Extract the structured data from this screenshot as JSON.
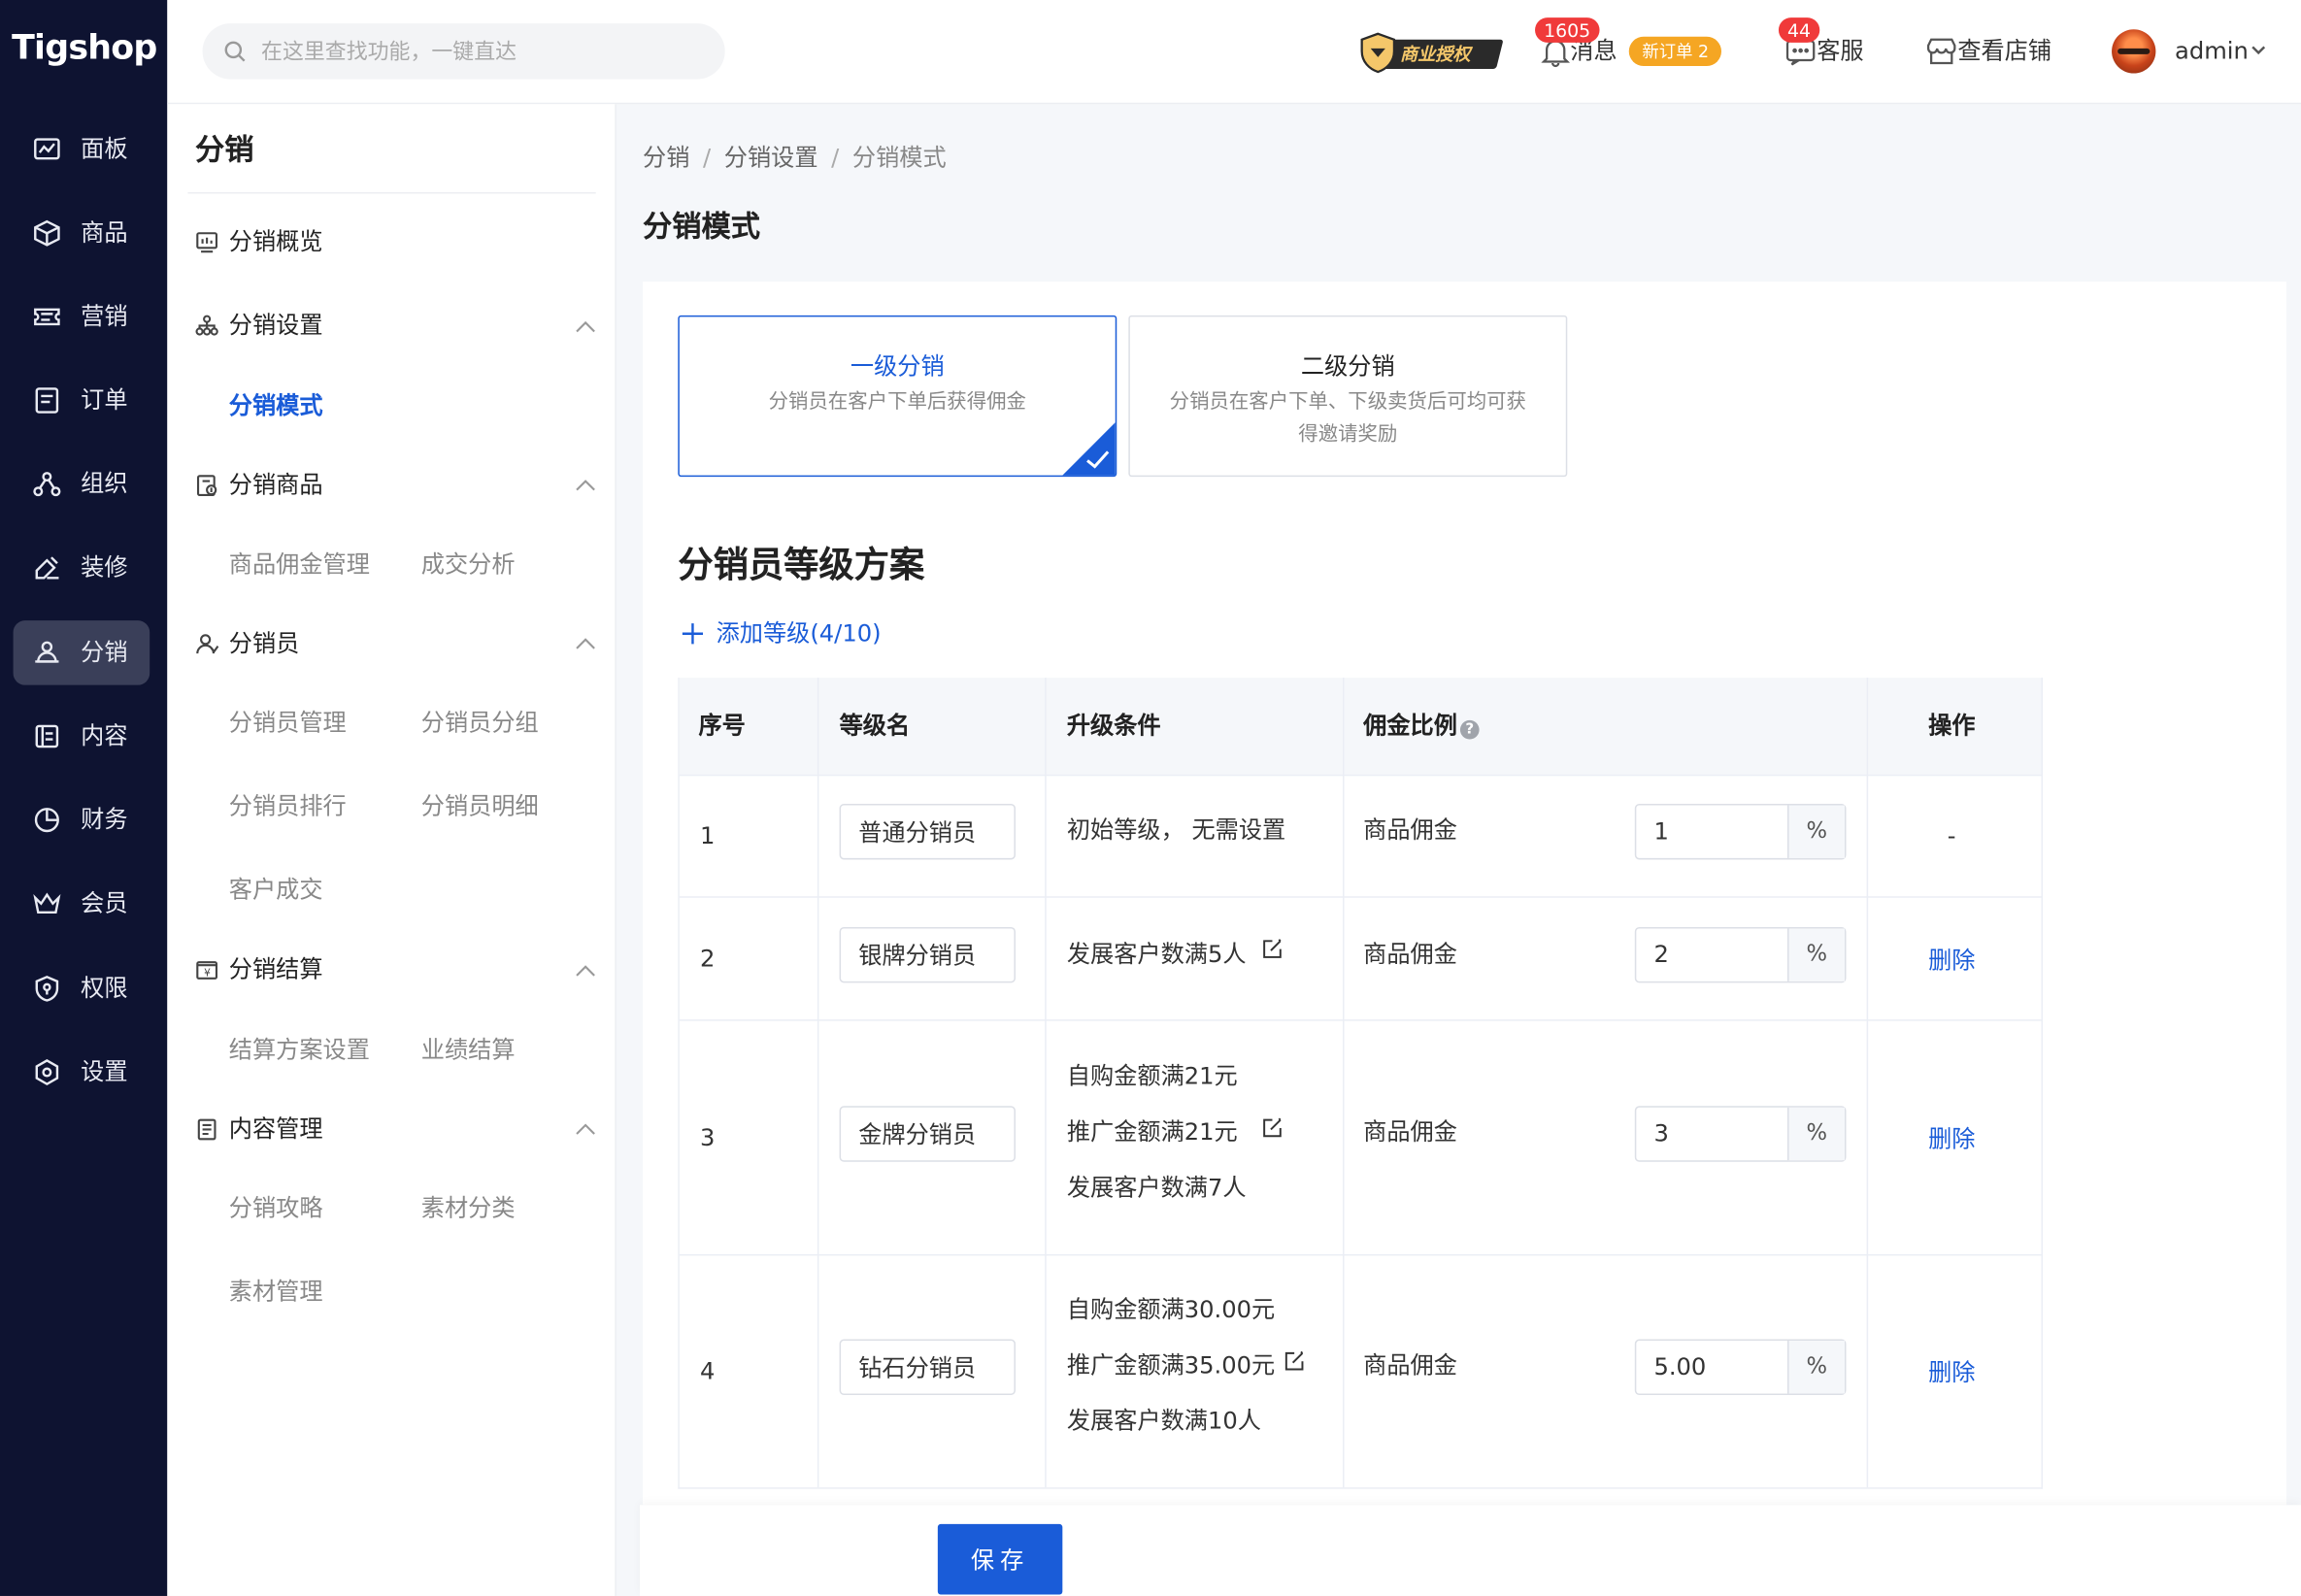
{
  "brand": "Tigshop",
  "rail": [
    {
      "label": "面板",
      "icon": "dashboard-icon"
    },
    {
      "label": "商品",
      "icon": "cube-icon"
    },
    {
      "label": "营销",
      "icon": "ticket-icon"
    },
    {
      "label": "订单",
      "icon": "order-icon"
    },
    {
      "label": "组织",
      "icon": "org-icon"
    },
    {
      "label": "装修",
      "icon": "brush-icon"
    },
    {
      "label": "分销",
      "icon": "distribution-icon",
      "active": true
    },
    {
      "label": "内容",
      "icon": "content-icon"
    },
    {
      "label": "财务",
      "icon": "finance-icon"
    },
    {
      "label": "会员",
      "icon": "member-icon"
    },
    {
      "label": "权限",
      "icon": "permission-icon"
    },
    {
      "label": "设置",
      "icon": "settings-icon"
    }
  ],
  "topbar": {
    "search_placeholder": "在这里查找功能，一键直达",
    "license": "商业授权",
    "messages_label": "消息",
    "messages_count": "1605",
    "new_order": "新订单 2",
    "service_label": "客服",
    "service_count": "44",
    "shop_label": "查看店铺",
    "user": "admin"
  },
  "sidebar": {
    "title": "分销",
    "overview": "分销概览",
    "groups": [
      {
        "label": "分销设置",
        "items": [
          "分销模式"
        ]
      },
      {
        "label": "分销商品",
        "items": [
          "商品佣金管理",
          "成交分析"
        ]
      },
      {
        "label": "分销员",
        "items": [
          "分销员管理",
          "分销员分组",
          "分销员排行",
          "分销员明细",
          "客户成交"
        ]
      },
      {
        "label": "分销结算",
        "items": [
          "结算方案设置",
          "业绩结算"
        ]
      },
      {
        "label": "内容管理",
        "items": [
          "分销攻略",
          "素材分类",
          "素材管理"
        ]
      }
    ],
    "active_item": "分销模式"
  },
  "breadcrumb": [
    "分销",
    "分销设置",
    "分销模式"
  ],
  "page_title": "分销模式",
  "modes": [
    {
      "title": "一级分销",
      "desc": "分销员在客户下单后获得佣金",
      "selected": true
    },
    {
      "title": "二级分销",
      "desc": "分销员在客户下单、下级卖货后可均可获得邀请奖励",
      "selected": false
    }
  ],
  "level_section": {
    "title": "分销员等级方案",
    "add_label": "添加等级(4/10)"
  },
  "table": {
    "headers": [
      "序号",
      "等级名",
      "升级条件",
      "佣金比例",
      "操作"
    ],
    "rows": [
      {
        "index": "1",
        "name": "普通分销员",
        "conditions": [
          "初始等级，  无需设置"
        ],
        "commission_label": "商品佣金",
        "rate": "1",
        "unit": "%",
        "action": "-"
      },
      {
        "index": "2",
        "name": "银牌分销员",
        "conditions": [
          "发展客户数满5人"
        ],
        "commission_label": "商品佣金",
        "rate": "2",
        "unit": "%",
        "action": "删除"
      },
      {
        "index": "3",
        "name": "金牌分销员",
        "conditions": [
          "自购金额满21元",
          "推广金额满21元",
          "发展客户数满7人"
        ],
        "commission_label": "商品佣金",
        "rate": "3",
        "unit": "%",
        "action": "删除"
      },
      {
        "index": "4",
        "name": "钻石分销员",
        "conditions": [
          "自购金额满30.00元",
          "推广金额满35.00元",
          "发展客户数满10人"
        ],
        "commission_label": "商品佣金",
        "rate": "5.00",
        "unit": "%",
        "action": "删除"
      }
    ]
  },
  "save_label": "保存",
  "colors": {
    "primary": "#1a5cd8",
    "rail": "#0e1331",
    "badge": "#f03a3a",
    "order_pill": "#f5a623"
  }
}
